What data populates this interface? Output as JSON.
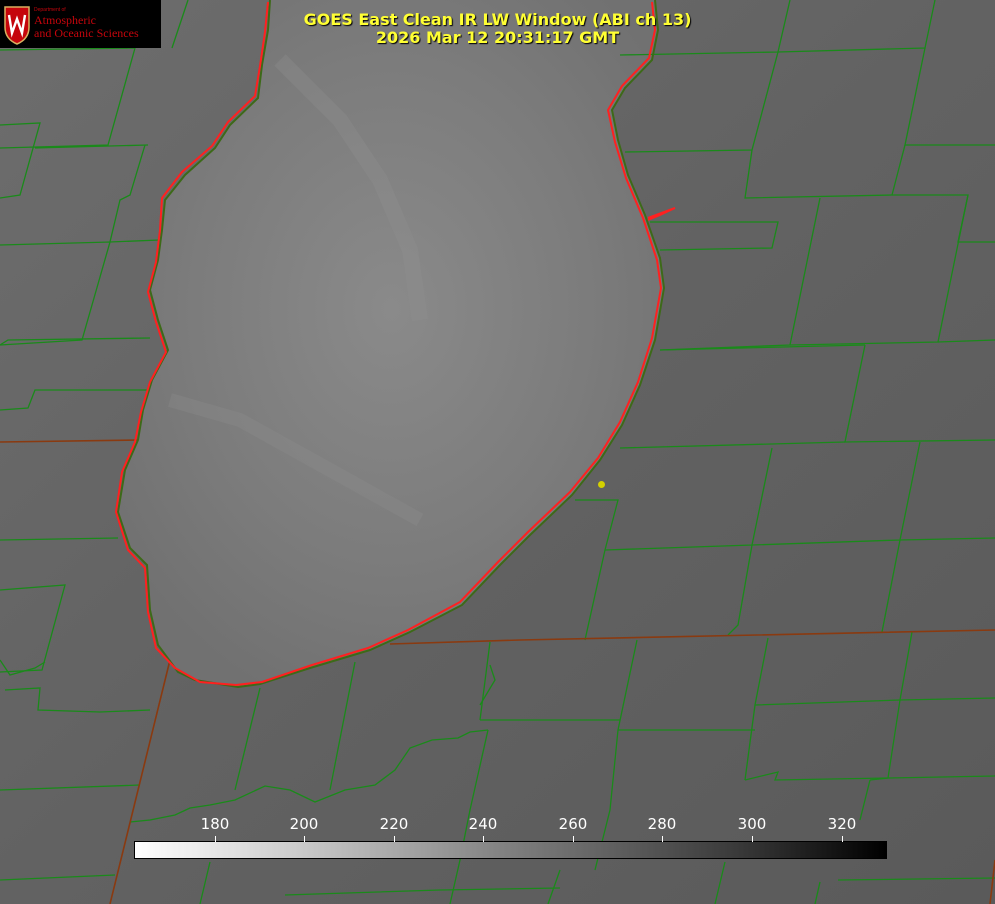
{
  "logo": {
    "dept": "Department of",
    "line1": "Atmospheric",
    "line2": "and Oceanic Sciences"
  },
  "title": {
    "line1": "GOES East Clean IR LW Window (ABI ch 13)",
    "line2": "2026 Mar 12 20:31:17 GMT"
  },
  "colorbar": {
    "ticks": [
      "180",
      "200",
      "220",
      "240",
      "260",
      "280",
      "300",
      "320"
    ]
  },
  "colors": {
    "title": "#ffff33",
    "coastline": "#ff2020",
    "boundaries": "#1a8a1a",
    "state_lines": "#8a3a10",
    "station": "#d4d000"
  }
}
